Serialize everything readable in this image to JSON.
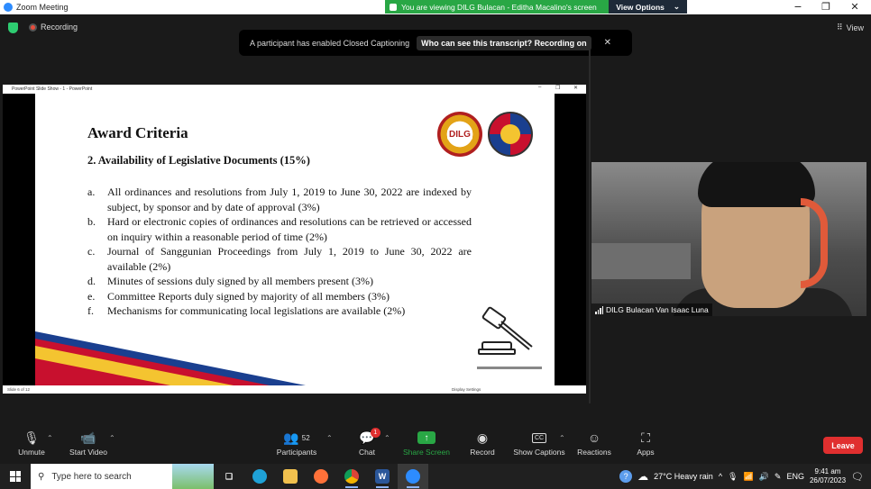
{
  "window": {
    "title": "Zoom Meeting",
    "share_banner": "You are viewing DILG Bulacan - Editha Macalino's screen",
    "view_options": "View Options",
    "minimize": "−",
    "maximize": "❐",
    "close": "✕"
  },
  "topbar": {
    "recording": "Recording",
    "view": "View",
    "cc_message": "A participant has enabled Closed Captioning",
    "cc_link": "Who can see this transcript? Recording on",
    "cc_close": "✕"
  },
  "powerpoint": {
    "window_title": "PowerPoint Slide Show - 1 - PowerPoint",
    "status_left": "Slide 6 of 12",
    "status_right": "Display Settings"
  },
  "slide": {
    "title": "Award Criteria",
    "subtitle": "2. Availability of Legislative Documents (15%)",
    "logo_text": "DILG",
    "criteria": [
      {
        "marker": "a.",
        "text": "All ordinances and resolutions from July 1, 2019 to June 30, 2022 are indexed by subject, by sponsor and by date of approval (3%)"
      },
      {
        "marker": "b.",
        "text": "Hard or electronic copies of ordinances and resolutions can be retrieved or accessed on inquiry within a reasonable period of time (2%)"
      },
      {
        "marker": "c.",
        "text": "Journal of Sanggunian Proceedings from July 1, 2019 to June 30, 2022 are available (2%)"
      },
      {
        "marker": "d.",
        "text": "Minutes of sessions duly signed by all members present (3%)"
      },
      {
        "marker": "e.",
        "text": "Committee Reports duly signed by majority of all members (3%)"
      },
      {
        "marker": "f.",
        "text": "Mechanisms for communicating local legislations are available (2%)"
      }
    ]
  },
  "video": {
    "participant_name": "DILG Bulacan Van Isaac Luna"
  },
  "toolbar": {
    "unmute": "Unmute",
    "start_video": "Start Video",
    "participants": "Participants",
    "participants_count": "52",
    "chat": "Chat",
    "chat_badge": "1",
    "share_screen": "Share Screen",
    "record": "Record",
    "show_captions": "Show Captions",
    "reactions": "Reactions",
    "apps": "Apps",
    "leave": "Leave",
    "cc_icon": "CC"
  },
  "taskbar": {
    "search_placeholder": "Type here to search",
    "weather": "27°C  Heavy rain",
    "language": "ENG",
    "time": "9:41 am",
    "date": "26/07/2023"
  },
  "colors": {
    "zoom_green": "#29a745",
    "leave_red": "#e02f2f",
    "zoom_blue": "#2d8cff"
  }
}
